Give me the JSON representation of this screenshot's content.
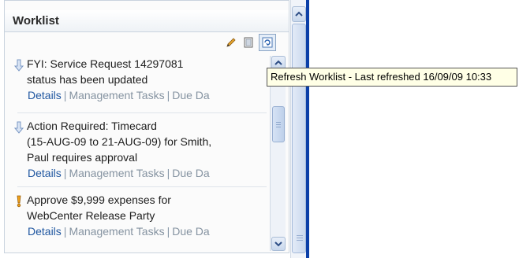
{
  "panel": {
    "title": "Worklist"
  },
  "toolbar": {
    "edit_icon": "pencil-icon",
    "view_icon": "view-icon",
    "refresh_icon": "refresh-icon"
  },
  "tooltip": {
    "text": "Refresh Worklist - Last refreshed 16/09/09 10:33"
  },
  "items": [
    {
      "icon": "arrow-down-icon",
      "title_lines": [
        "FYI: Service Request 14297081",
        "status has been updated"
      ],
      "links": {
        "details": "Details",
        "sep1": "|",
        "tasks": "Management Tasks",
        "sep2": "|",
        "due": "Due Da"
      }
    },
    {
      "icon": "arrow-down-icon",
      "title_lines": [
        "Action Required: Timecard",
        "(15-AUG-09 to 21-AUG-09) for Smith,",
        "Paul requires approval"
      ],
      "links": {
        "details": "Details",
        "sep1": "|",
        "tasks": "Management Tasks",
        "sep2": "|",
        "due": "Due Da"
      }
    },
    {
      "icon": "priority-exclamation-icon",
      "title_lines": [
        "Approve $9,999 expenses for",
        "WebCenter Release Party"
      ],
      "links": {
        "details": "Details",
        "sep1": "|",
        "tasks": "Management Tasks",
        "sep2": "|",
        "due": "Due Da"
      }
    }
  ],
  "colors": {
    "link": "#1f56a0",
    "window_edge": "#0b3fa8",
    "tooltip_bg": "#ffffe6"
  }
}
